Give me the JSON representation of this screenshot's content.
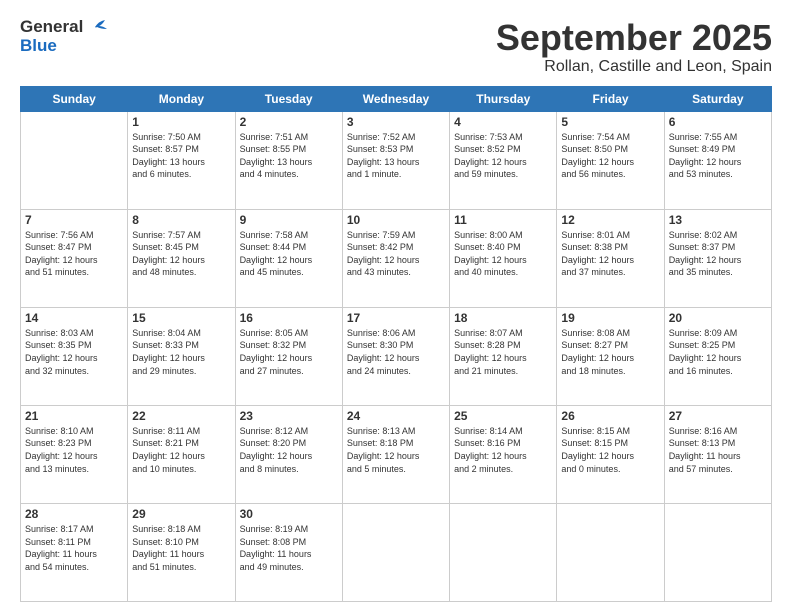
{
  "header": {
    "logo_general": "General",
    "logo_blue": "Blue",
    "title": "September 2025",
    "location": "Rollan, Castille and Leon, Spain"
  },
  "weekdays": [
    "Sunday",
    "Monday",
    "Tuesday",
    "Wednesday",
    "Thursday",
    "Friday",
    "Saturday"
  ],
  "weeks": [
    [
      {
        "day": "",
        "info": ""
      },
      {
        "day": "1",
        "info": "Sunrise: 7:50 AM\nSunset: 8:57 PM\nDaylight: 13 hours\nand 6 minutes."
      },
      {
        "day": "2",
        "info": "Sunrise: 7:51 AM\nSunset: 8:55 PM\nDaylight: 13 hours\nand 4 minutes."
      },
      {
        "day": "3",
        "info": "Sunrise: 7:52 AM\nSunset: 8:53 PM\nDaylight: 13 hours\nand 1 minute."
      },
      {
        "day": "4",
        "info": "Sunrise: 7:53 AM\nSunset: 8:52 PM\nDaylight: 12 hours\nand 59 minutes."
      },
      {
        "day": "5",
        "info": "Sunrise: 7:54 AM\nSunset: 8:50 PM\nDaylight: 12 hours\nand 56 minutes."
      },
      {
        "day": "6",
        "info": "Sunrise: 7:55 AM\nSunset: 8:49 PM\nDaylight: 12 hours\nand 53 minutes."
      }
    ],
    [
      {
        "day": "7",
        "info": "Sunrise: 7:56 AM\nSunset: 8:47 PM\nDaylight: 12 hours\nand 51 minutes."
      },
      {
        "day": "8",
        "info": "Sunrise: 7:57 AM\nSunset: 8:45 PM\nDaylight: 12 hours\nand 48 minutes."
      },
      {
        "day": "9",
        "info": "Sunrise: 7:58 AM\nSunset: 8:44 PM\nDaylight: 12 hours\nand 45 minutes."
      },
      {
        "day": "10",
        "info": "Sunrise: 7:59 AM\nSunset: 8:42 PM\nDaylight: 12 hours\nand 43 minutes."
      },
      {
        "day": "11",
        "info": "Sunrise: 8:00 AM\nSunset: 8:40 PM\nDaylight: 12 hours\nand 40 minutes."
      },
      {
        "day": "12",
        "info": "Sunrise: 8:01 AM\nSunset: 8:38 PM\nDaylight: 12 hours\nand 37 minutes."
      },
      {
        "day": "13",
        "info": "Sunrise: 8:02 AM\nSunset: 8:37 PM\nDaylight: 12 hours\nand 35 minutes."
      }
    ],
    [
      {
        "day": "14",
        "info": "Sunrise: 8:03 AM\nSunset: 8:35 PM\nDaylight: 12 hours\nand 32 minutes."
      },
      {
        "day": "15",
        "info": "Sunrise: 8:04 AM\nSunset: 8:33 PM\nDaylight: 12 hours\nand 29 minutes."
      },
      {
        "day": "16",
        "info": "Sunrise: 8:05 AM\nSunset: 8:32 PM\nDaylight: 12 hours\nand 27 minutes."
      },
      {
        "day": "17",
        "info": "Sunrise: 8:06 AM\nSunset: 8:30 PM\nDaylight: 12 hours\nand 24 minutes."
      },
      {
        "day": "18",
        "info": "Sunrise: 8:07 AM\nSunset: 8:28 PM\nDaylight: 12 hours\nand 21 minutes."
      },
      {
        "day": "19",
        "info": "Sunrise: 8:08 AM\nSunset: 8:27 PM\nDaylight: 12 hours\nand 18 minutes."
      },
      {
        "day": "20",
        "info": "Sunrise: 8:09 AM\nSunset: 8:25 PM\nDaylight: 12 hours\nand 16 minutes."
      }
    ],
    [
      {
        "day": "21",
        "info": "Sunrise: 8:10 AM\nSunset: 8:23 PM\nDaylight: 12 hours\nand 13 minutes."
      },
      {
        "day": "22",
        "info": "Sunrise: 8:11 AM\nSunset: 8:21 PM\nDaylight: 12 hours\nand 10 minutes."
      },
      {
        "day": "23",
        "info": "Sunrise: 8:12 AM\nSunset: 8:20 PM\nDaylight: 12 hours\nand 8 minutes."
      },
      {
        "day": "24",
        "info": "Sunrise: 8:13 AM\nSunset: 8:18 PM\nDaylight: 12 hours\nand 5 minutes."
      },
      {
        "day": "25",
        "info": "Sunrise: 8:14 AM\nSunset: 8:16 PM\nDaylight: 12 hours\nand 2 minutes."
      },
      {
        "day": "26",
        "info": "Sunrise: 8:15 AM\nSunset: 8:15 PM\nDaylight: 12 hours\nand 0 minutes."
      },
      {
        "day": "27",
        "info": "Sunrise: 8:16 AM\nSunset: 8:13 PM\nDaylight: 11 hours\nand 57 minutes."
      }
    ],
    [
      {
        "day": "28",
        "info": "Sunrise: 8:17 AM\nSunset: 8:11 PM\nDaylight: 11 hours\nand 54 minutes."
      },
      {
        "day": "29",
        "info": "Sunrise: 8:18 AM\nSunset: 8:10 PM\nDaylight: 11 hours\nand 51 minutes."
      },
      {
        "day": "30",
        "info": "Sunrise: 8:19 AM\nSunset: 8:08 PM\nDaylight: 11 hours\nand 49 minutes."
      },
      {
        "day": "",
        "info": ""
      },
      {
        "day": "",
        "info": ""
      },
      {
        "day": "",
        "info": ""
      },
      {
        "day": "",
        "info": ""
      }
    ]
  ]
}
